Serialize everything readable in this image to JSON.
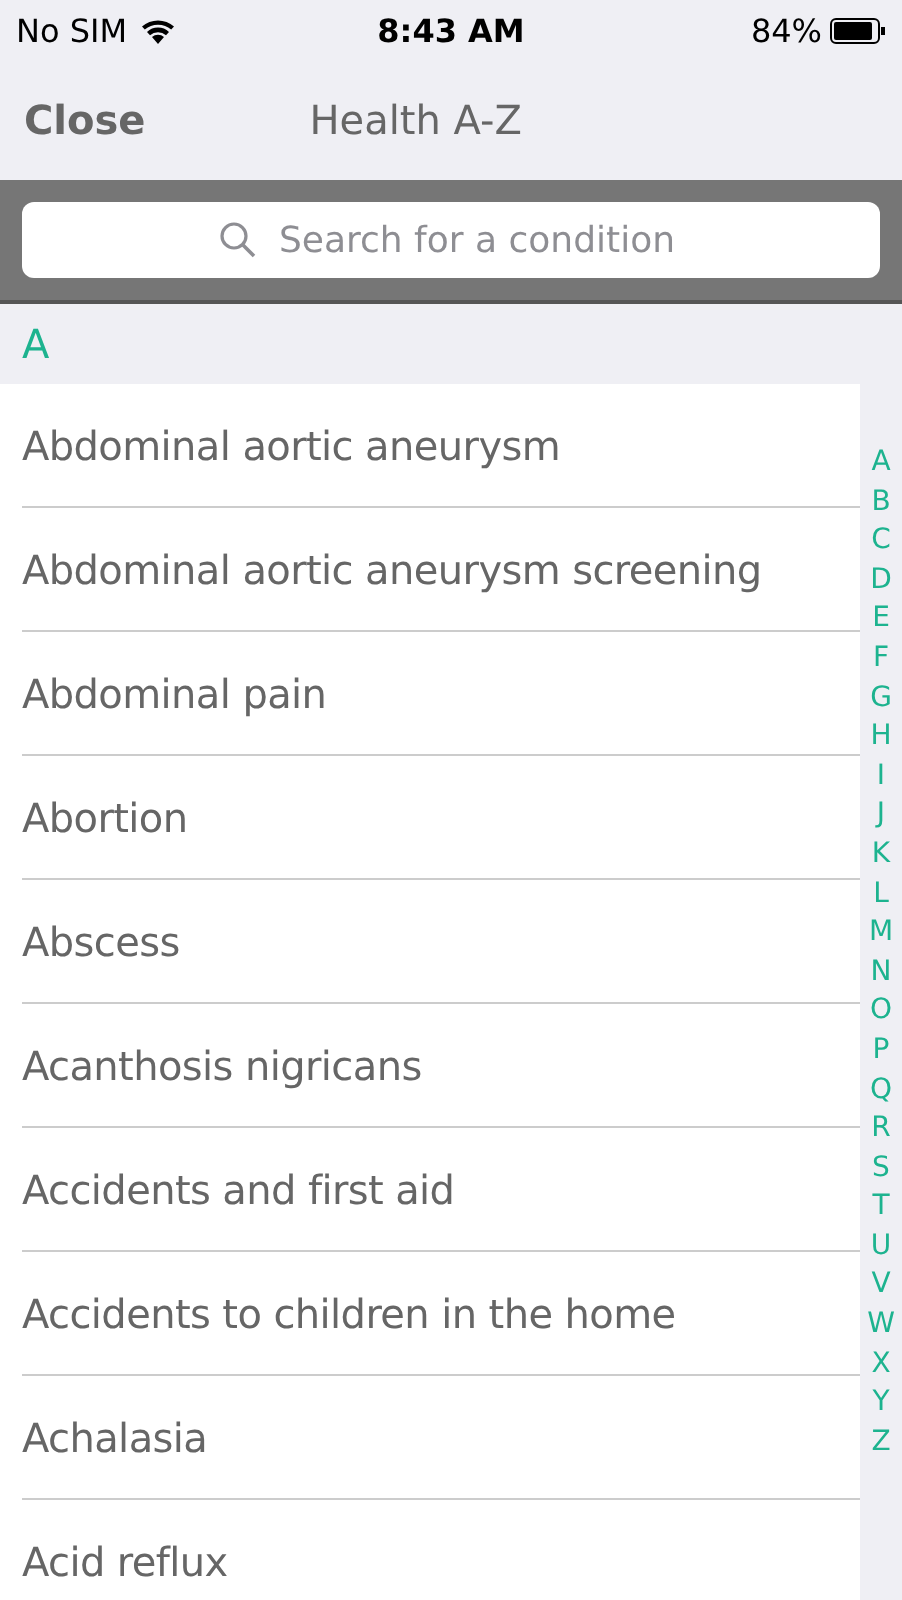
{
  "status_bar": {
    "carrier": "No SIM",
    "time": "8:43 AM",
    "battery": "84%"
  },
  "nav": {
    "close": "Close",
    "title": "Health A-Z"
  },
  "search": {
    "placeholder": "Search for a condition"
  },
  "section": {
    "header": "A"
  },
  "items": [
    "Abdominal aortic aneurysm",
    "Abdominal aortic aneurysm screening",
    "Abdominal pain",
    "Abortion",
    "Abscess",
    "Acanthosis nigricans",
    "Accidents and first aid",
    "Accidents to children in the home",
    "Achalasia",
    "Acid reflux"
  ],
  "index": [
    "A",
    "B",
    "C",
    "D",
    "E",
    "F",
    "G",
    "H",
    "I",
    "J",
    "K",
    "L",
    "M",
    "N",
    "O",
    "P",
    "Q",
    "R",
    "S",
    "T",
    "U",
    "V",
    "W",
    "X",
    "Y",
    "Z"
  ]
}
